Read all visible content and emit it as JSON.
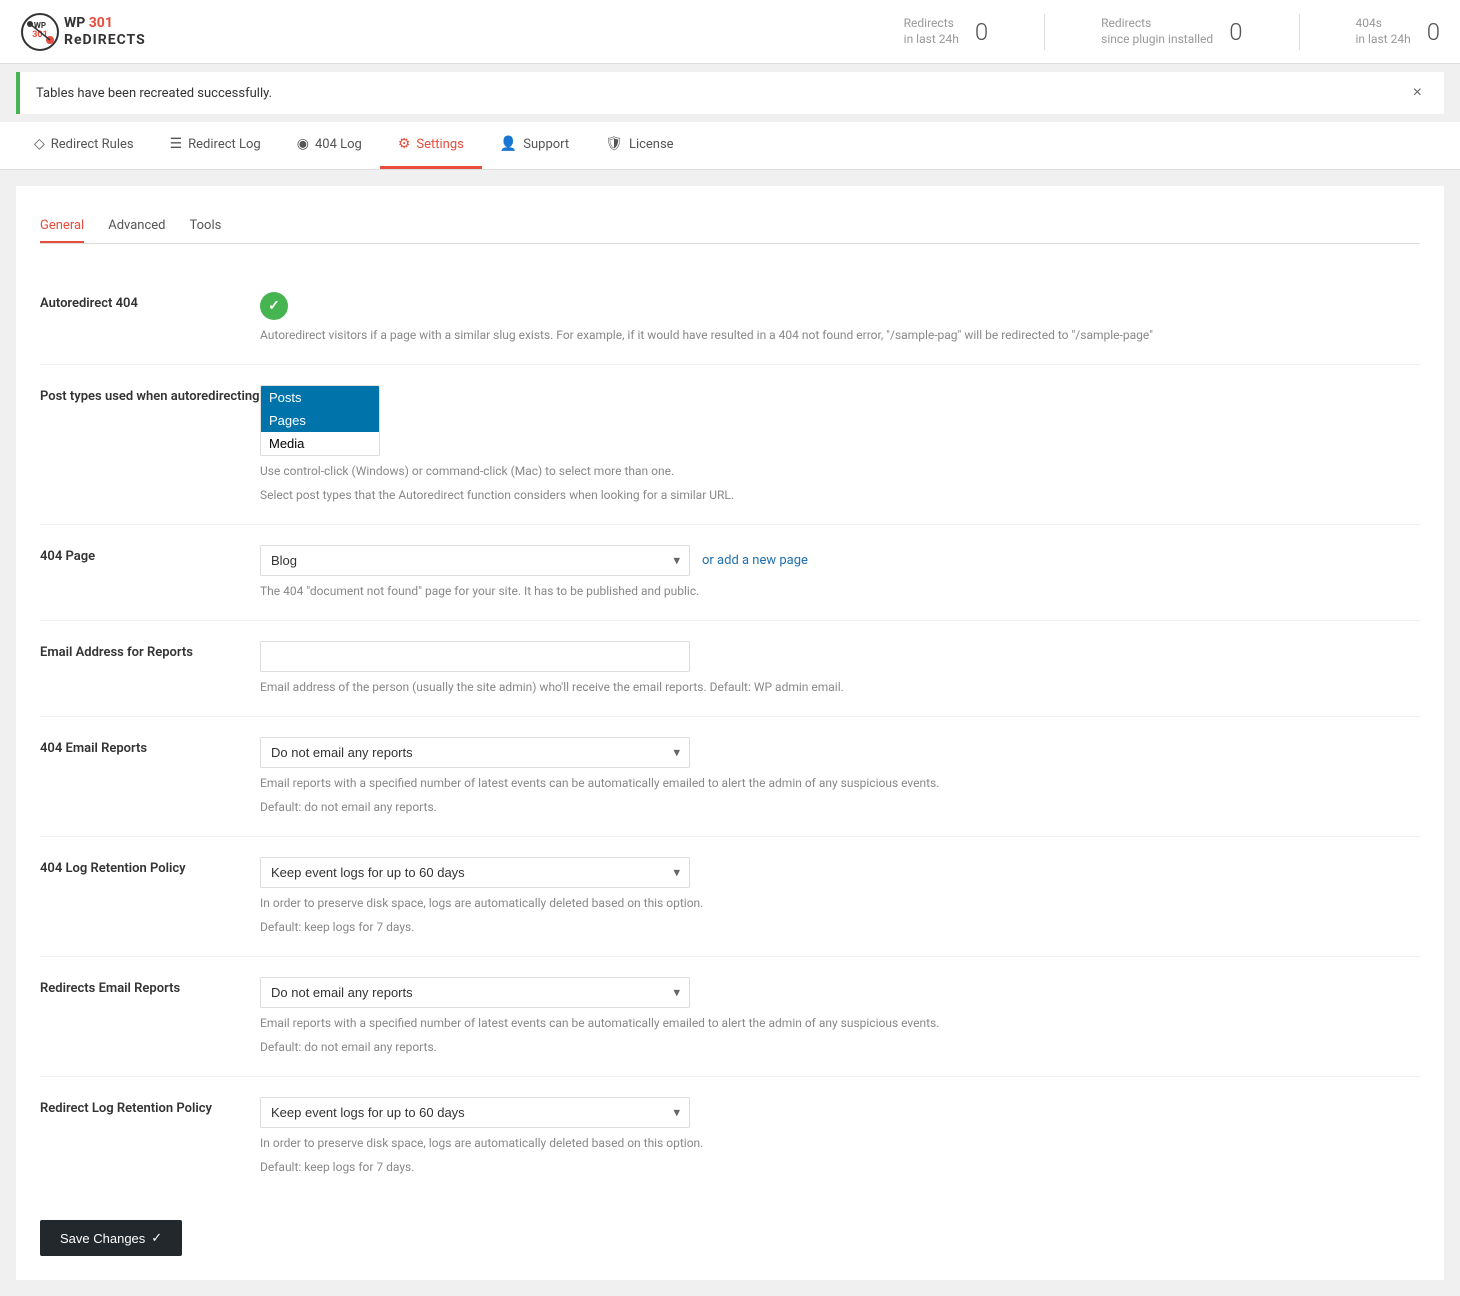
{
  "header": {
    "logo_wp": "WP",
    "logo_301": "301",
    "logo_redirects": "ReDIRECTS",
    "stats": [
      {
        "label": "Redirects",
        "sublabel": "in last 24h",
        "value": "0"
      },
      {
        "label": "Redirects",
        "sublabel": "since plugin installed",
        "value": "0"
      },
      {
        "label": "404s",
        "sublabel": "in last 24h",
        "value": "0"
      }
    ]
  },
  "notice": {
    "text": "Tables have been recreated successfully.",
    "close_label": "×"
  },
  "nav_tabs": [
    {
      "id": "redirect-rules",
      "label": "Redirect Rules",
      "icon": "◇",
      "active": false
    },
    {
      "id": "redirect-log",
      "label": "Redirect Log",
      "icon": "☰",
      "active": false
    },
    {
      "id": "404-log",
      "label": "404 Log",
      "icon": "◉",
      "active": false
    },
    {
      "id": "settings",
      "label": "Settings",
      "icon": "⚙",
      "active": true
    },
    {
      "id": "support",
      "label": "Support",
      "icon": "👤",
      "active": false
    },
    {
      "id": "license",
      "label": "License",
      "icon": "🛡",
      "active": false
    }
  ],
  "sub_tabs": [
    {
      "id": "general",
      "label": "General",
      "active": true
    },
    {
      "id": "advanced",
      "label": "Advanced",
      "active": false
    },
    {
      "id": "tools",
      "label": "Tools",
      "active": false
    }
  ],
  "form": {
    "autoredirect": {
      "label": "Autoredirect 404",
      "desc": "Autoredirect visitors if a page with a similar slug exists. For example, if it would have resulted in a 404 not found error, \"/sample-pag\" will be redirected to \"/sample-page\""
    },
    "post_types": {
      "label": "Post types used when autoredirecting",
      "options": [
        "Posts",
        "Pages",
        "Media"
      ],
      "selected": [
        "Posts",
        "Pages"
      ],
      "desc1": "Use control-click (Windows) or command-click (Mac) to select more than one.",
      "desc2": "Select post types that the Autoredirect function considers when looking for a similar URL."
    },
    "page_404": {
      "label": "404 Page",
      "selected": "Blog",
      "link_text": "or add a new page",
      "desc": "The 404 \"document not found\" page for your site. It has to be published and public."
    },
    "email_address": {
      "label": "Email Address for Reports",
      "placeholder": "",
      "desc": "Email address of the person (usually the site admin) who'll receive the email reports. Default: WP admin email."
    },
    "email_404": {
      "label": "404 Email Reports",
      "selected": "Do not email any reports",
      "desc1": "Email reports with a specified number of latest events can be automatically emailed to alert the admin of any suspicious events.",
      "desc2": "Default: do not email any reports."
    },
    "log_retention_404": {
      "label": "404 Log Retention Policy",
      "selected": "Keep event logs for up to 60 days",
      "desc1": "In order to preserve disk space, logs are automatically deleted based on this option.",
      "desc2": "Default: keep logs for 7 days."
    },
    "redirects_email": {
      "label": "Redirects Email Reports",
      "selected": "Do not email any reports",
      "desc1": "Email reports with a specified number of latest events can be automatically emailed to alert the admin of any suspicious events.",
      "desc2": "Default: do not email any reports."
    },
    "redirect_log_retention": {
      "label": "Redirect Log Retention Policy",
      "selected": "Keep event logs for up to 60 days",
      "desc1": "In order to preserve disk space, logs are automatically deleted based on this option.",
      "desc2": "Default: keep logs for 7 days."
    }
  },
  "save_button": "Save Changes"
}
